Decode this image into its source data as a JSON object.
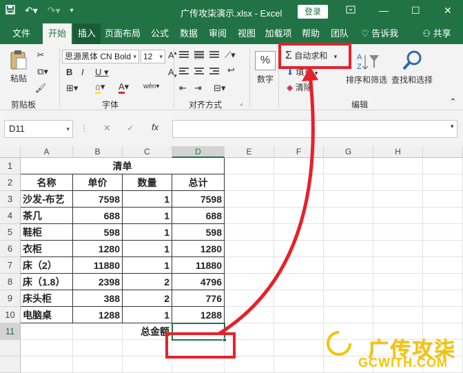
{
  "window": {
    "title": "广传攻柒演示.xlsx  -  Excel",
    "login_label": "登录"
  },
  "tabs": [
    "文件",
    "开始",
    "插入",
    "页面布局",
    "公式",
    "数据",
    "审阅",
    "视图",
    "加载项",
    "帮助",
    "团队"
  ],
  "tell_me": "告诉我",
  "share": "共享",
  "ribbon": {
    "paste_label": "粘贴",
    "font_name": "思源黑体 CN Bold",
    "font_size": "12",
    "number_label": "数字",
    "autosum_label": "自动求和",
    "fill_label": "填充",
    "clear_label": "清除",
    "sort_filter_label": "排序和筛选",
    "find_select_label": "查找和选择",
    "groups": {
      "clipboard": "剪贴板",
      "font": "字体",
      "alignment": "对齐方式",
      "editing": "编辑"
    }
  },
  "formula_bar": {
    "name_box": "D11",
    "fx_label": "fx",
    "formula": ""
  },
  "sheet": {
    "columns": [
      "A",
      "B",
      "C",
      "D",
      "E",
      "F",
      "G",
      "H"
    ],
    "rows": [
      "1",
      "2",
      "3",
      "4",
      "5",
      "6",
      "7",
      "8",
      "9",
      "10",
      "11"
    ],
    "title": "清单",
    "headers": [
      "名称",
      "单价",
      "数量",
      "总计"
    ],
    "items": [
      {
        "name": "沙发-布艺",
        "price": "7598",
        "qty": "1",
        "total": "7598"
      },
      {
        "name": "茶几",
        "price": "688",
        "qty": "1",
        "total": "688"
      },
      {
        "name": "鞋柜",
        "price": "598",
        "qty": "1",
        "total": "598"
      },
      {
        "name": "衣柜",
        "price": "1280",
        "qty": "1",
        "total": "1280"
      },
      {
        "name": "床（2）",
        "price": "11880",
        "qty": "1",
        "total": "11880"
      },
      {
        "name": "床（1.8）",
        "price": "2398",
        "qty": "2",
        "total": "4796"
      },
      {
        "name": "床头柜",
        "price": "388",
        "qty": "2",
        "total": "776"
      },
      {
        "name": "电脑桌",
        "price": "1288",
        "qty": "1",
        "total": "1288"
      }
    ],
    "total_label": "总金额",
    "total_value": ""
  },
  "watermark": {
    "text": "广传攻柒",
    "sub": "GCWITH.COM"
  },
  "colors": {
    "excel_green": "#217346",
    "highlight_red": "#e8202a",
    "watermark_yellow": "#f5c400"
  }
}
